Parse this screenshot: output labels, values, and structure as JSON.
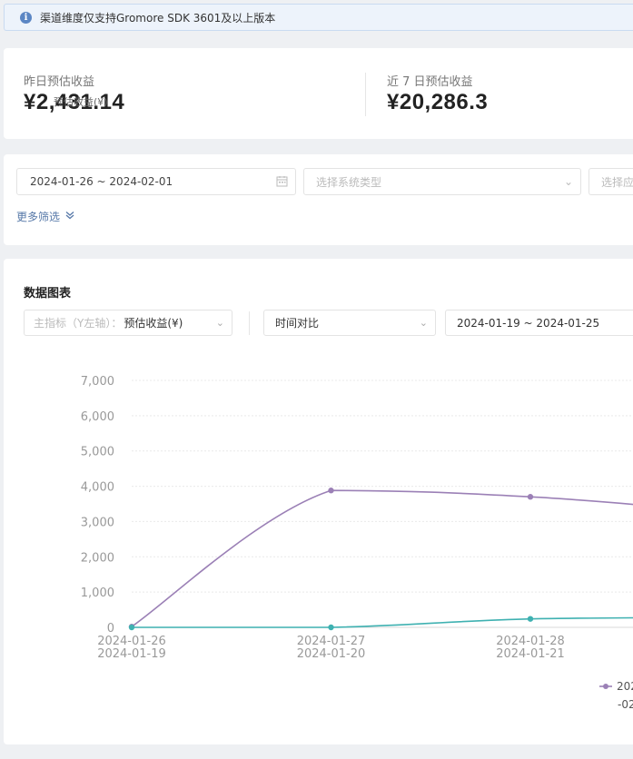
{
  "notice": {
    "text": "渠道维度仅支持Gromore SDK 3601及以上版本",
    "icon": "info-icon"
  },
  "stats": {
    "yesterday": {
      "label": "昨日预估收益",
      "value": "¥2,431.14"
    },
    "last7": {
      "label": "近 7 日预估收益",
      "value": "¥20,286.3"
    }
  },
  "filters": {
    "date_range": "2024-01-26 ~ 2024-02-01",
    "system_type_placeholder": "选择系统类型",
    "app_placeholder": "选择应",
    "more_label": "更多筛选"
  },
  "chart_panel": {
    "title": "数据图表",
    "metric_label": "主指标（Y左轴）：",
    "metric_value": "预估收益(¥)",
    "compare_mode": "时间对比",
    "compare_range": "2024-01-19 ~ 2024-01-25"
  },
  "chart_data": {
    "type": "line",
    "ylabel": "预估收益(¥)",
    "ylim": [
      0,
      7000
    ],
    "yticks": [
      "7,000",
      "6,000",
      "5,000",
      "4,000",
      "3,000",
      "2,000",
      "1,000",
      "0"
    ],
    "categories_primary": [
      "2024-01-26",
      "2024-01-27",
      "2024-01-28"
    ],
    "categories_secondary": [
      "2024-01-19",
      "2024-01-20",
      "2024-01-21"
    ],
    "series": [
      {
        "name": "202",
        "color": "#9b80b6",
        "values": [
          20,
          3880,
          3700,
          3250
        ]
      },
      {
        "name": "-02",
        "color": "#3fb1b1",
        "values": [
          0,
          0,
          240,
          280
        ]
      }
    ],
    "legend": "bottom-right"
  }
}
